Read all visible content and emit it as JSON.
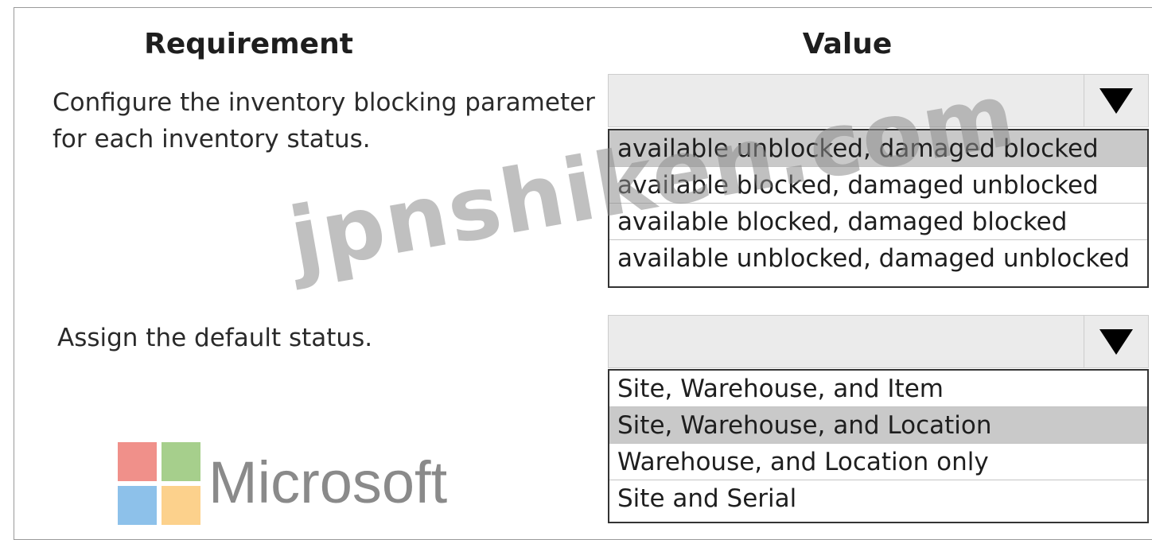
{
  "headers": {
    "requirement": "Requirement",
    "value": "Value"
  },
  "rows": [
    {
      "requirement_lines": [
        "Configure the inventory blocking parameter",
        "for each inventory status."
      ],
      "selected_value": "",
      "options": [
        "available unblocked, damaged blocked",
        "available blocked, damaged unblocked",
        "available blocked, damaged blocked",
        "available unblocked, damaged unblocked"
      ],
      "highlighted_option_index": 0
    },
    {
      "requirement_lines": [
        "Assign the default status."
      ],
      "selected_value": "",
      "options": [
        "Site, Warehouse, and Item",
        "Site, Warehouse, and Location",
        "Warehouse, and Location only",
        "Site and Serial"
      ],
      "highlighted_option_index": 1
    }
  ],
  "watermark": "jpnshiken.com",
  "logo": {
    "text": "Microsoft",
    "colors": [
      "#f0908a",
      "#a6cf8c",
      "#8dc1ea",
      "#fcd18c"
    ]
  },
  "icons": {
    "dropdown_arrow": "triangle-down-icon"
  }
}
